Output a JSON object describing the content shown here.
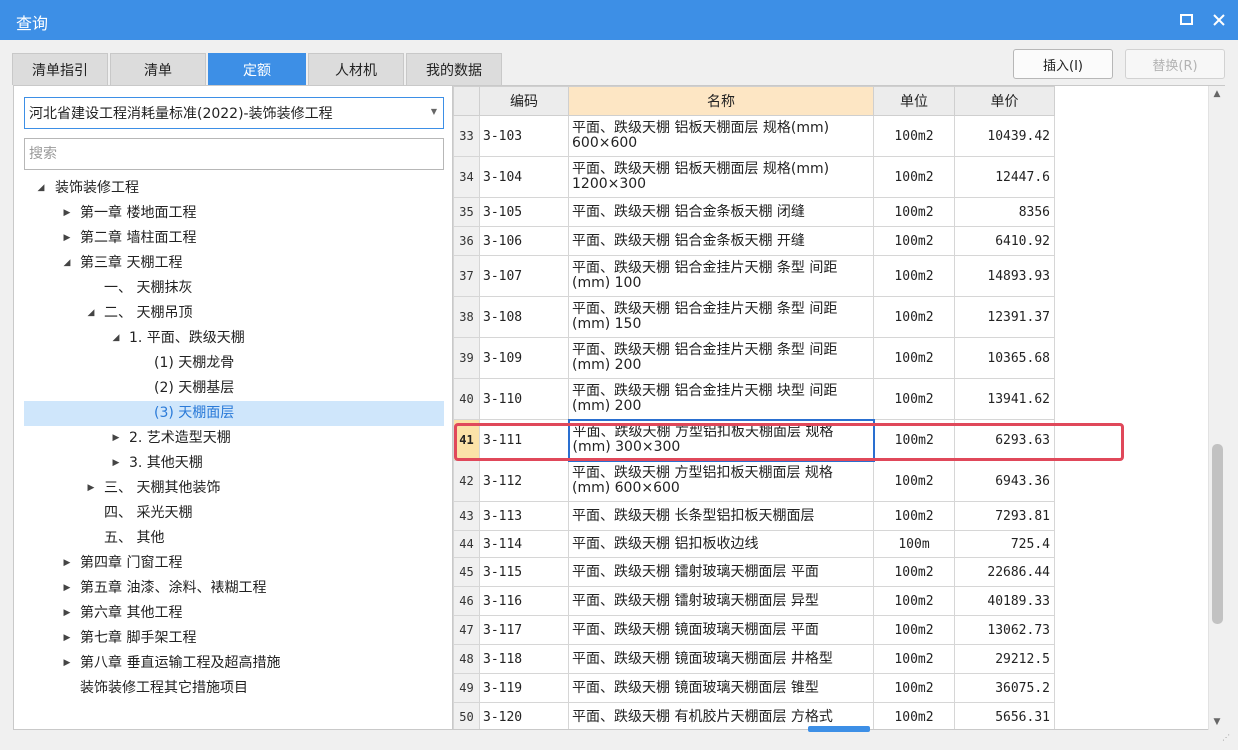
{
  "window": {
    "title": "查询"
  },
  "tabs": [
    "清单指引",
    "清单",
    "定额",
    "人材机",
    "我的数据"
  ],
  "active_tab": "定额",
  "buttons": {
    "insert": "插入(I)",
    "replace": "替换(R)"
  },
  "library_select": {
    "value": "河北省建设工程消耗量标准(2022)-装饰装修工程"
  },
  "search": {
    "placeholder": "搜索"
  },
  "tree": [
    {
      "label": "装饰装修工程",
      "level": 0,
      "toggle": "expanded"
    },
    {
      "label": "第一章 楼地面工程",
      "level": 1,
      "toggle": "collapsed"
    },
    {
      "label": "第二章 墙柱面工程",
      "level": 1,
      "toggle": "collapsed"
    },
    {
      "label": "第三章 天棚工程",
      "level": 1,
      "toggle": "expanded"
    },
    {
      "label": "一、 天棚抹灰",
      "level": 2,
      "toggle": "none"
    },
    {
      "label": "二、 天棚吊顶",
      "level": 2,
      "toggle": "expanded"
    },
    {
      "label": "1. 平面、跌级天棚",
      "level": 3,
      "toggle": "expanded"
    },
    {
      "label": "(1) 天棚龙骨",
      "level": 4,
      "toggle": "none"
    },
    {
      "label": "(2) 天棚基层",
      "level": 4,
      "toggle": "none"
    },
    {
      "label": "(3) 天棚面层",
      "level": 4,
      "toggle": "none",
      "selected": true
    },
    {
      "label": "2. 艺术造型天棚",
      "level": 3,
      "toggle": "collapsed"
    },
    {
      "label": "3. 其他天棚",
      "level": 3,
      "toggle": "collapsed"
    },
    {
      "label": "三、 天棚其他装饰",
      "level": 2,
      "toggle": "collapsed"
    },
    {
      "label": "四、 采光天棚",
      "level": 2,
      "toggle": "none"
    },
    {
      "label": "五、 其他",
      "level": 2,
      "toggle": "none"
    },
    {
      "label": "第四章 门窗工程",
      "level": 1,
      "toggle": "collapsed"
    },
    {
      "label": "第五章 油漆、涂料、裱糊工程",
      "level": 1,
      "toggle": "collapsed"
    },
    {
      "label": "第六章 其他工程",
      "level": 1,
      "toggle": "collapsed"
    },
    {
      "label": "第七章 脚手架工程",
      "level": 1,
      "toggle": "collapsed"
    },
    {
      "label": "第八章 垂直运输工程及超高措施",
      "level": 1,
      "toggle": "collapsed"
    },
    {
      "label": "装饰装修工程其它措施项目",
      "level": 1,
      "toggle": "none"
    }
  ],
  "grid": {
    "columns": [
      "编码",
      "名称",
      "单位",
      "单价"
    ],
    "current_row": 41,
    "rows": [
      {
        "n": "33",
        "code": "3-103",
        "name": "平面、跌级天棚 铝板天棚面层 规格(mm) 600×600",
        "unit": "100m2",
        "price": "10439.42"
      },
      {
        "n": "34",
        "code": "3-104",
        "name": "平面、跌级天棚 铝板天棚面层 规格(mm) 1200×300",
        "unit": "100m2",
        "price": "12447.6"
      },
      {
        "n": "35",
        "code": "3-105",
        "name": "平面、跌级天棚 铝合金条板天棚 闭缝",
        "unit": "100m2",
        "price": "8356"
      },
      {
        "n": "36",
        "code": "3-106",
        "name": "平面、跌级天棚 铝合金条板天棚 开缝",
        "unit": "100m2",
        "price": "6410.92"
      },
      {
        "n": "37",
        "code": "3-107",
        "name": "平面、跌级天棚 铝合金挂片天棚 条型 间距(mm) 100",
        "unit": "100m2",
        "price": "14893.93"
      },
      {
        "n": "38",
        "code": "3-108",
        "name": "平面、跌级天棚 铝合金挂片天棚 条型 间距(mm) 150",
        "unit": "100m2",
        "price": "12391.37"
      },
      {
        "n": "39",
        "code": "3-109",
        "name": "平面、跌级天棚 铝合金挂片天棚 条型 间距(mm) 200",
        "unit": "100m2",
        "price": "10365.68"
      },
      {
        "n": "40",
        "code": "3-110",
        "name": "平面、跌级天棚 铝合金挂片天棚 块型 间距(mm) 200",
        "unit": "100m2",
        "price": "13941.62"
      },
      {
        "n": "41",
        "code": "3-111",
        "name": "平面、跌级天棚 方型铝扣板天棚面层 规格(mm) 300×300",
        "unit": "100m2",
        "price": "6293.63"
      },
      {
        "n": "42",
        "code": "3-112",
        "name": "平面、跌级天棚 方型铝扣板天棚面层 规格(mm) 600×600",
        "unit": "100m2",
        "price": "6943.36"
      },
      {
        "n": "43",
        "code": "3-113",
        "name": "平面、跌级天棚 长条型铝扣板天棚面层",
        "unit": "100m2",
        "price": "7293.81"
      },
      {
        "n": "44",
        "code": "3-114",
        "name": "平面、跌级天棚 铝扣板收边线",
        "unit": "100m",
        "price": "725.4"
      },
      {
        "n": "45",
        "code": "3-115",
        "name": "平面、跌级天棚 镭射玻璃天棚面层 平面",
        "unit": "100m2",
        "price": "22686.44"
      },
      {
        "n": "46",
        "code": "3-116",
        "name": "平面、跌级天棚 镭射玻璃天棚面层 异型",
        "unit": "100m2",
        "price": "40189.33"
      },
      {
        "n": "47",
        "code": "3-117",
        "name": "平面、跌级天棚 镜面玻璃天棚面层 平面",
        "unit": "100m2",
        "price": "13062.73"
      },
      {
        "n": "48",
        "code": "3-118",
        "name": "平面、跌级天棚 镜面玻璃天棚面层 井格型",
        "unit": "100m2",
        "price": "29212.5"
      },
      {
        "n": "49",
        "code": "3-119",
        "name": "平面、跌级天棚 镜面玻璃天棚面层 锥型",
        "unit": "100m2",
        "price": "36075.2"
      },
      {
        "n": "50",
        "code": "3-120",
        "name": "平面、跌级天棚 有机胶片天棚面层 方格式",
        "unit": "100m2",
        "price": "5656.31"
      }
    ]
  },
  "colors": {
    "accent": "#3d8fe6",
    "highlight": "#e0485a",
    "selected_tree": "#cfe6fb",
    "name_header": "#fde6c4"
  },
  "icons": {
    "maximize": "maximize-icon",
    "close": "close-icon",
    "dropdown": "chevron-down-icon",
    "expanded": "triangle-down-icon",
    "collapsed": "triangle-right-icon"
  }
}
